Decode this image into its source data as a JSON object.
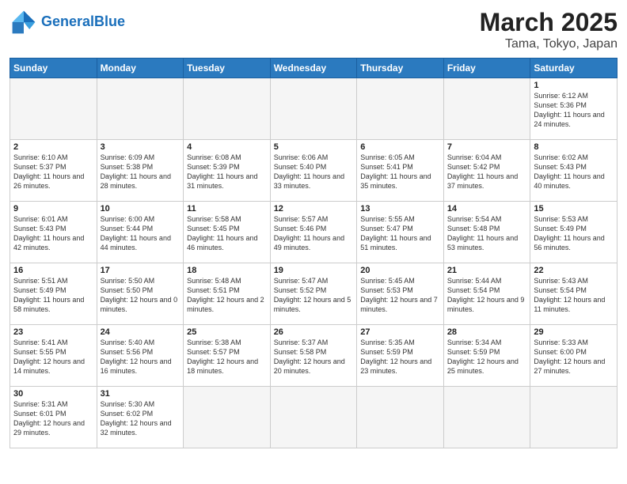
{
  "header": {
    "logo_general": "General",
    "logo_blue": "Blue",
    "main_title": "March 2025",
    "sub_title": "Tama, Tokyo, Japan"
  },
  "weekdays": [
    "Sunday",
    "Monday",
    "Tuesday",
    "Wednesday",
    "Thursday",
    "Friday",
    "Saturday"
  ],
  "weeks": [
    [
      {
        "num": "",
        "info": ""
      },
      {
        "num": "",
        "info": ""
      },
      {
        "num": "",
        "info": ""
      },
      {
        "num": "",
        "info": ""
      },
      {
        "num": "",
        "info": ""
      },
      {
        "num": "",
        "info": ""
      },
      {
        "num": "1",
        "info": "Sunrise: 6:12 AM\nSunset: 5:36 PM\nDaylight: 11 hours\nand 24 minutes."
      }
    ],
    [
      {
        "num": "2",
        "info": "Sunrise: 6:10 AM\nSunset: 5:37 PM\nDaylight: 11 hours\nand 26 minutes."
      },
      {
        "num": "3",
        "info": "Sunrise: 6:09 AM\nSunset: 5:38 PM\nDaylight: 11 hours\nand 28 minutes."
      },
      {
        "num": "4",
        "info": "Sunrise: 6:08 AM\nSunset: 5:39 PM\nDaylight: 11 hours\nand 31 minutes."
      },
      {
        "num": "5",
        "info": "Sunrise: 6:06 AM\nSunset: 5:40 PM\nDaylight: 11 hours\nand 33 minutes."
      },
      {
        "num": "6",
        "info": "Sunrise: 6:05 AM\nSunset: 5:41 PM\nDaylight: 11 hours\nand 35 minutes."
      },
      {
        "num": "7",
        "info": "Sunrise: 6:04 AM\nSunset: 5:42 PM\nDaylight: 11 hours\nand 37 minutes."
      },
      {
        "num": "8",
        "info": "Sunrise: 6:02 AM\nSunset: 5:43 PM\nDaylight: 11 hours\nand 40 minutes."
      }
    ],
    [
      {
        "num": "9",
        "info": "Sunrise: 6:01 AM\nSunset: 5:43 PM\nDaylight: 11 hours\nand 42 minutes."
      },
      {
        "num": "10",
        "info": "Sunrise: 6:00 AM\nSunset: 5:44 PM\nDaylight: 11 hours\nand 44 minutes."
      },
      {
        "num": "11",
        "info": "Sunrise: 5:58 AM\nSunset: 5:45 PM\nDaylight: 11 hours\nand 46 minutes."
      },
      {
        "num": "12",
        "info": "Sunrise: 5:57 AM\nSunset: 5:46 PM\nDaylight: 11 hours\nand 49 minutes."
      },
      {
        "num": "13",
        "info": "Sunrise: 5:55 AM\nSunset: 5:47 PM\nDaylight: 11 hours\nand 51 minutes."
      },
      {
        "num": "14",
        "info": "Sunrise: 5:54 AM\nSunset: 5:48 PM\nDaylight: 11 hours\nand 53 minutes."
      },
      {
        "num": "15",
        "info": "Sunrise: 5:53 AM\nSunset: 5:49 PM\nDaylight: 11 hours\nand 56 minutes."
      }
    ],
    [
      {
        "num": "16",
        "info": "Sunrise: 5:51 AM\nSunset: 5:49 PM\nDaylight: 11 hours\nand 58 minutes."
      },
      {
        "num": "17",
        "info": "Sunrise: 5:50 AM\nSunset: 5:50 PM\nDaylight: 12 hours\nand 0 minutes."
      },
      {
        "num": "18",
        "info": "Sunrise: 5:48 AM\nSunset: 5:51 PM\nDaylight: 12 hours\nand 2 minutes."
      },
      {
        "num": "19",
        "info": "Sunrise: 5:47 AM\nSunset: 5:52 PM\nDaylight: 12 hours\nand 5 minutes."
      },
      {
        "num": "20",
        "info": "Sunrise: 5:45 AM\nSunset: 5:53 PM\nDaylight: 12 hours\nand 7 minutes."
      },
      {
        "num": "21",
        "info": "Sunrise: 5:44 AM\nSunset: 5:54 PM\nDaylight: 12 hours\nand 9 minutes."
      },
      {
        "num": "22",
        "info": "Sunrise: 5:43 AM\nSunset: 5:54 PM\nDaylight: 12 hours\nand 11 minutes."
      }
    ],
    [
      {
        "num": "23",
        "info": "Sunrise: 5:41 AM\nSunset: 5:55 PM\nDaylight: 12 hours\nand 14 minutes."
      },
      {
        "num": "24",
        "info": "Sunrise: 5:40 AM\nSunset: 5:56 PM\nDaylight: 12 hours\nand 16 minutes."
      },
      {
        "num": "25",
        "info": "Sunrise: 5:38 AM\nSunset: 5:57 PM\nDaylight: 12 hours\nand 18 minutes."
      },
      {
        "num": "26",
        "info": "Sunrise: 5:37 AM\nSunset: 5:58 PM\nDaylight: 12 hours\nand 20 minutes."
      },
      {
        "num": "27",
        "info": "Sunrise: 5:35 AM\nSunset: 5:59 PM\nDaylight: 12 hours\nand 23 minutes."
      },
      {
        "num": "28",
        "info": "Sunrise: 5:34 AM\nSunset: 5:59 PM\nDaylight: 12 hours\nand 25 minutes."
      },
      {
        "num": "29",
        "info": "Sunrise: 5:33 AM\nSunset: 6:00 PM\nDaylight: 12 hours\nand 27 minutes."
      }
    ],
    [
      {
        "num": "30",
        "info": "Sunrise: 5:31 AM\nSunset: 6:01 PM\nDaylight: 12 hours\nand 29 minutes."
      },
      {
        "num": "31",
        "info": "Sunrise: 5:30 AM\nSunset: 6:02 PM\nDaylight: 12 hours\nand 32 minutes."
      },
      {
        "num": "",
        "info": ""
      },
      {
        "num": "",
        "info": ""
      },
      {
        "num": "",
        "info": ""
      },
      {
        "num": "",
        "info": ""
      },
      {
        "num": "",
        "info": ""
      }
    ]
  ]
}
